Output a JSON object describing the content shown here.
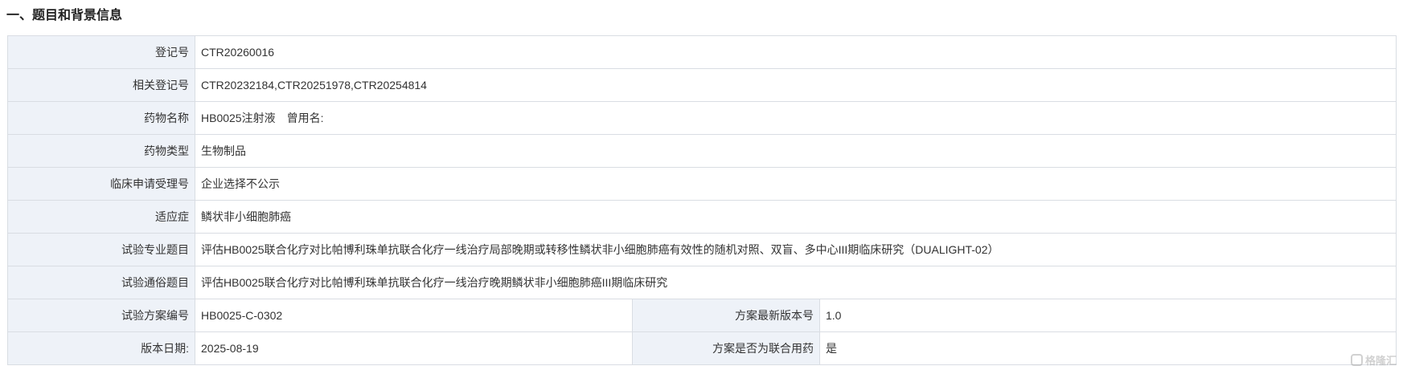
{
  "section_title": "一、题目和背景信息",
  "rows": [
    {
      "label": "登记号",
      "value": "CTR20260016"
    },
    {
      "label": "相关登记号",
      "value": "CTR20232184,CTR20251978,CTR20254814"
    },
    {
      "label": "药物名称",
      "value": "HB0025注射液",
      "extra": "曾用名:"
    },
    {
      "label": "药物类型",
      "value": "生物制品"
    },
    {
      "label": "临床申请受理号",
      "value": "企业选择不公示"
    },
    {
      "label": "适应症",
      "value": "鳞状非小细胞肺癌"
    },
    {
      "label": "试验专业题目",
      "value": "评估HB0025联合化疗对比帕博利珠单抗联合化疗一线治疗局部晚期或转移性鳞状非小细胞肺癌有效性的随机对照、双盲、多中心III期临床研究（DUALIGHT-02）"
    },
    {
      "label": "试验通俗题目",
      "value": "评估HB0025联合化疗对比帕博利珠单抗联合化疗一线治疗晚期鳞状非小细胞肺癌III期临床研究"
    }
  ],
  "split_rows": [
    {
      "label": "试验方案编号",
      "value": "HB0025-C-0302",
      "label2": "方案最新版本号",
      "value2": "1.0"
    },
    {
      "label": "版本日期:",
      "value": "2025-08-19",
      "label2": "方案是否为联合用药",
      "value2": "是"
    }
  ],
  "watermark": {
    "text": "格隆汇",
    "icon": "gelonghui-logo-icon"
  }
}
